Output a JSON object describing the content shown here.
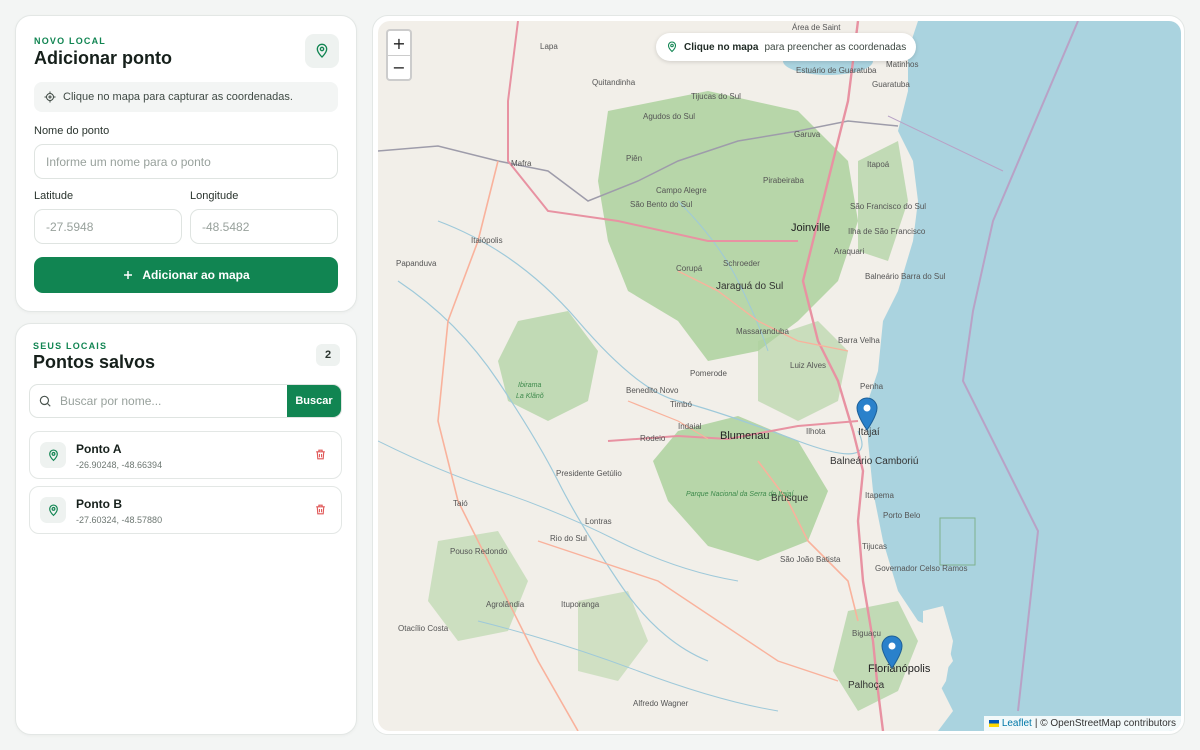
{
  "add_form": {
    "eyebrow": "NOVO LOCAL",
    "title": "Adicionar ponto",
    "hint": "Clique no mapa para capturar as coordenadas.",
    "name_label": "Nome do ponto",
    "name_placeholder": "Informe um nome para o ponto",
    "lat_label": "Latitude",
    "lat_placeholder": "-27.5948",
    "lng_label": "Longitude",
    "lng_placeholder": "-48.5482",
    "submit_label": "Adicionar ao mapa"
  },
  "saved": {
    "eyebrow": "SEUS LOCAIS",
    "title": "Pontos salvos",
    "count": "2",
    "search_placeholder": "Buscar por nome...",
    "search_button": "Buscar",
    "items": [
      {
        "name": "Ponto A",
        "coords": "-26.90248, -48.66394"
      },
      {
        "name": "Ponto B",
        "coords": "-27.60324, -48.57880"
      }
    ]
  },
  "map": {
    "hint_bold": "Clique no mapa",
    "hint_rest": "para preencher as coordenadas",
    "zoom_in": "+",
    "zoom_out": "−",
    "attribution_link": "Leaflet",
    "attribution_rest": "| © OpenStreetMap contributors",
    "labels": {
      "lapa": "Lapa",
      "quitandinha": "Quitandinha",
      "tijucas_sul": "Tijucas do Sul",
      "agudos": "Agudos do Sul",
      "mafra": "Mafra",
      "pien": "Piên",
      "campo_alegre": "Campo Alegre",
      "sao_bento": "São Bento do Sul",
      "pirabeiraba": "Pirabeiraba",
      "joinville": "Joinville",
      "araquari": "Araquari",
      "garuva": "Garuva",
      "itapoa": "Itapoá",
      "guaratuba": "Guaratuba",
      "matinhos": "Matinhos",
      "area_saint": "Área de Saint",
      "estuario": "Estuário de Guaratuba",
      "sao_francisco": "São Francisco do Sul",
      "ilha": "Ilha de São Francisco",
      "itaiopolis": "Itaiópolis",
      "papanduva": "Papanduva",
      "corupa": "Corupá",
      "schroeder": "Schroeder",
      "jaragua": "Jaraguá do Sul",
      "balneario_barra": "Balneário Barra do Sul",
      "massaranduba": "Massaranduba",
      "barra_velha": "Barra Velha",
      "pomerode": "Pomerode",
      "luiz_alves": "Luiz Alves",
      "penha": "Penha",
      "benedito": "Benedito Novo",
      "timbo": "Timbó",
      "ibirama": "Ibirama",
      "la_klano": "La Klãnõ",
      "rodeio": "Rodeio",
      "indaial": "Indaial",
      "blumenau": "Blumenau",
      "ilhota": "Ilhota",
      "itajai": "Itajaí",
      "balneario_camboriu": "Balneário Camboriú",
      "presidente_getulio": "Presidente Getúlio",
      "brusque": "Brusque",
      "parque": "Parque Nacional da Serra do Itajaí",
      "itapema": "Itapema",
      "porto_belo": "Porto Belo",
      "taio": "Taió",
      "lontras": "Lontras",
      "rio_do_sul": "Rio do Sul",
      "pouso_redondo": "Pouso Redondo",
      "sao_joao": "São João Batista",
      "tijucas": "Tijucas",
      "governador": "Governador Celso Ramos",
      "agrolandia": "Agrolândia",
      "ituporanga": "Ituporanga",
      "otacilio": "Otacílio Costa",
      "biguacu": "Biguaçu",
      "florianopolis": "Florianópolis",
      "palhoca": "Palhoça",
      "alfredo": "Alfredo Wagner"
    }
  },
  "colors": {
    "accent": "#118552",
    "danger": "#e05656",
    "map_land": "#f2efe9",
    "map_sea": "#aad3df",
    "map_forest": "#add19e",
    "marker": "#2a81cb"
  }
}
